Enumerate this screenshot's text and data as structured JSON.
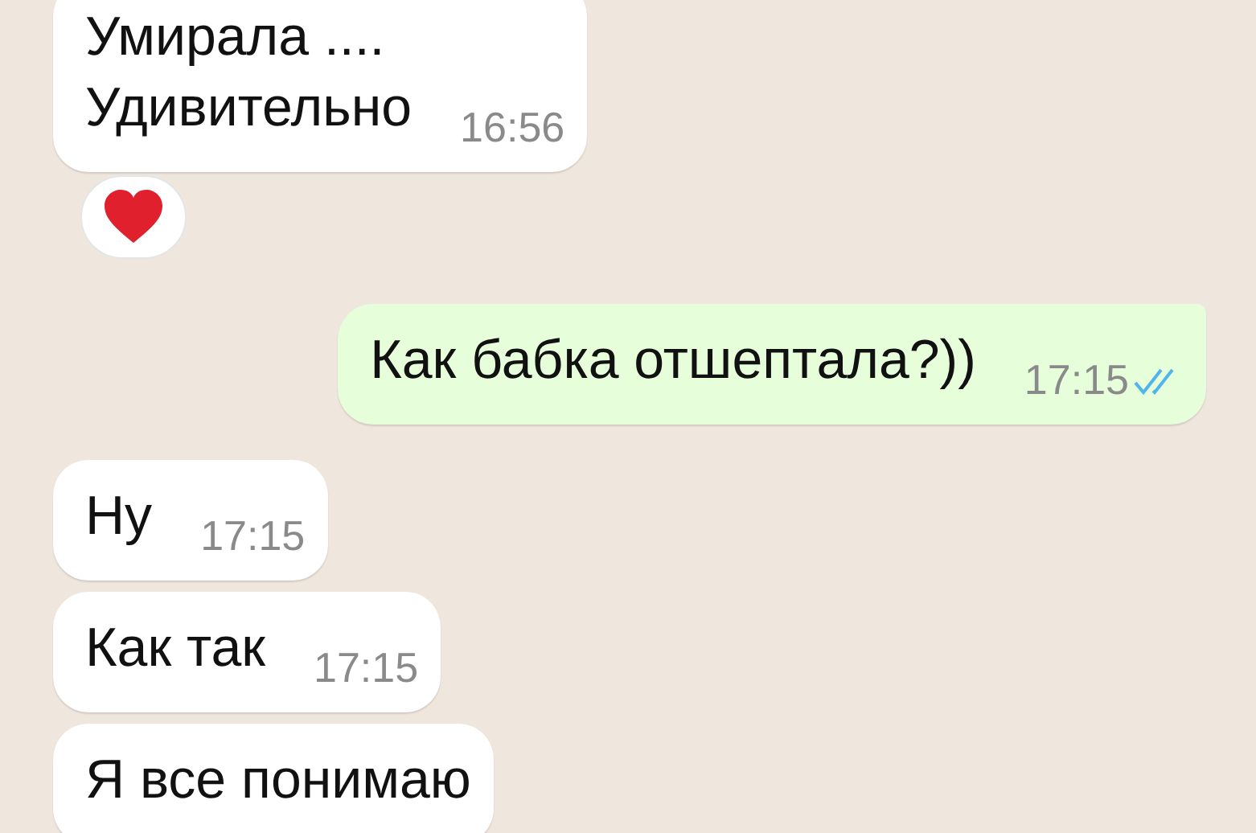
{
  "messages": [
    {
      "outgoing": false,
      "lines": [
        "Умирала ....",
        "Удивительно"
      ],
      "time": "16:56",
      "reaction": true
    },
    {
      "outgoing": true,
      "lines": [
        "Как бабка отшептала?))"
      ],
      "time": "17:15",
      "read": true
    },
    {
      "outgoing": false,
      "lines": [
        "Ну"
      ],
      "time": "17:15"
    },
    {
      "outgoing": false,
      "lines": [
        "Как так"
      ],
      "time": "17:15"
    },
    {
      "outgoing": false,
      "lines": [
        "Я все понимаю"
      ]
    }
  ]
}
